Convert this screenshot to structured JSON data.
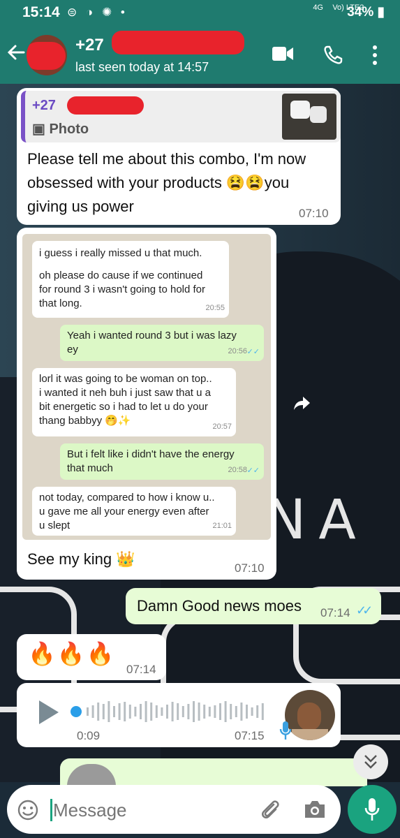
{
  "status_bar": {
    "time": "15:14",
    "network": "4G",
    "volte": "Vo) LTE2",
    "battery": "34%"
  },
  "header": {
    "contact": "+27",
    "last_seen": "last seen today at 14:57"
  },
  "messages": [
    {
      "reply_to": {
        "name": "+27",
        "type": "Photo"
      },
      "text_lines": [
        "Please tell me about this combo, I'm now",
        "obsessed with your products 😫😫you",
        "giving us power"
      ],
      "time": "07:10"
    },
    {
      "screenshot": [
        {
          "lines": [
            "i guess i really missed u that much.",
            "",
            "oh please do cause if we continued",
            "for round 3 i wasn't going to hold for",
            "that long."
          ],
          "time": "20:55"
        },
        {
          "lines": [
            "Yeah i wanted round 3 but i was lazy",
            "ey"
          ],
          "time": "20:56"
        },
        {
          "lines": [
            "lorl it was going to be woman on top..",
            "i wanted it neh buh i just saw that u a",
            "bit energetic so i had to let u do your",
            "thang babbyy 🤭✨"
          ],
          "time": "20:57"
        },
        {
          "lines": [
            "But i felt like i didn't have the energy",
            "that much"
          ],
          "time": "20:58"
        },
        {
          "lines": [
            "not today, compared to how i know u..",
            "u gave me all your energy even after",
            "u slept"
          ],
          "time": "21:01"
        }
      ],
      "caption": "See my king 👑",
      "time": "07:10"
    },
    {
      "text": "Damn Good news moes",
      "time": "07:14",
      "ticks": "✓✓"
    },
    {
      "text": "🔥🔥🔥",
      "time": "07:14"
    },
    {
      "voice_duration": "0:09",
      "time": "07:15"
    }
  ],
  "wallpaper_text": "NA",
  "input": {
    "placeholder": "Message"
  },
  "colors": {
    "header": "#1f7b6f",
    "outgoing": "#e7fcd6",
    "incoming": "#ffffff",
    "mic": "#1aa37f",
    "tick": "#4fb6ec"
  }
}
